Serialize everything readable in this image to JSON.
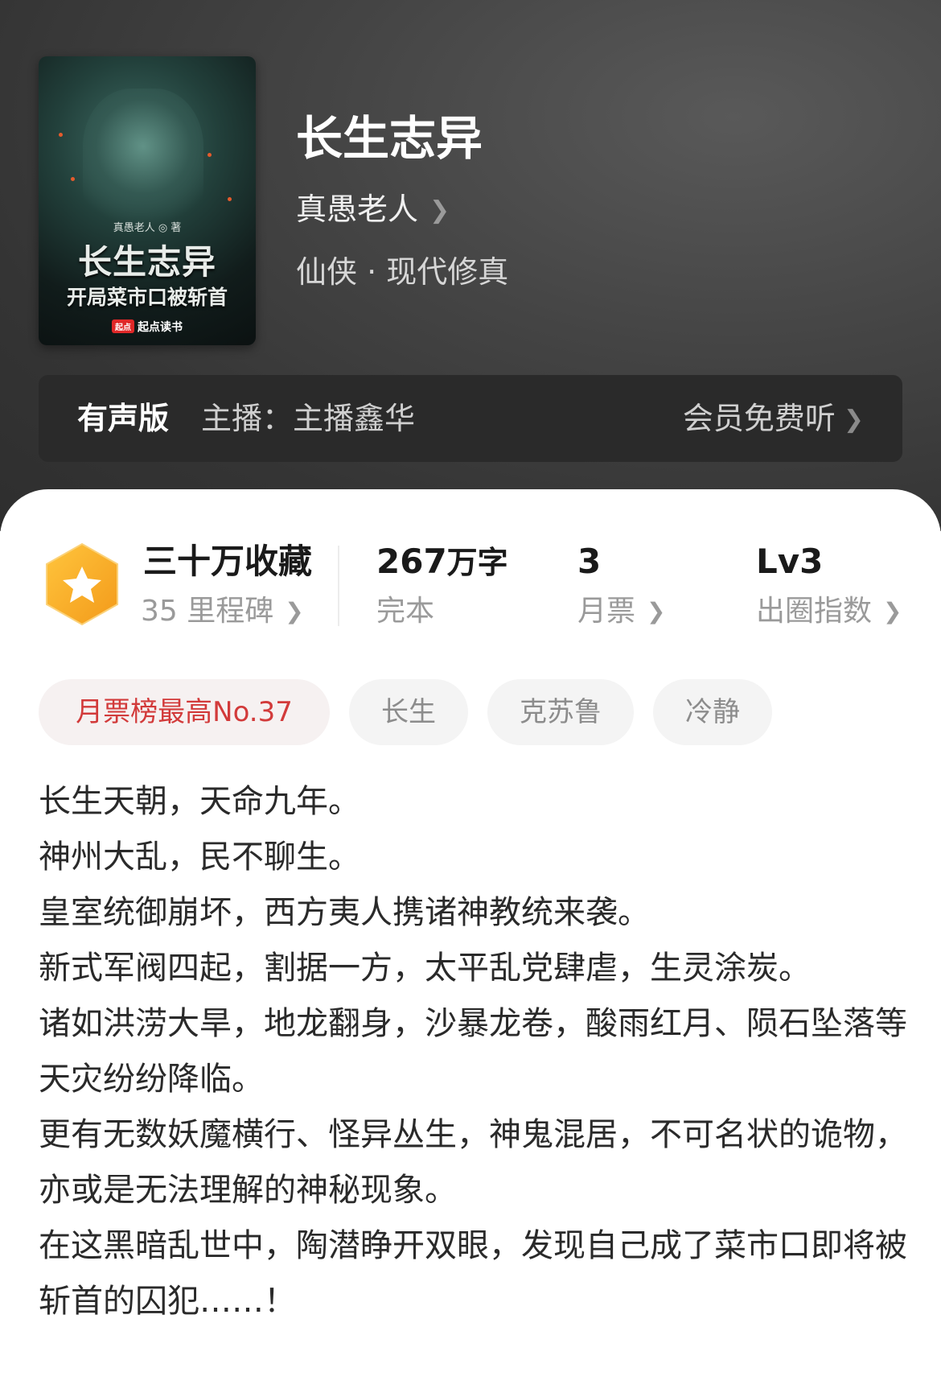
{
  "cover": {
    "author": "真愚老人 ◎ 著",
    "title": "长生志异",
    "subtitle": "开局菜市口被斩首",
    "publisher_badge": "起点",
    "publisher": "起点读书"
  },
  "book": {
    "title": "长生志异",
    "author": "真愚老人",
    "genre": "仙侠 · 现代修真"
  },
  "audio": {
    "label": "有声版",
    "host": "主播：主播鑫华",
    "cta": "会员免费听"
  },
  "stats": {
    "collection": {
      "main": "三十万收藏",
      "sub": "35 里程碑"
    },
    "words": {
      "number": "267",
      "unit": "万字",
      "sub": "完本"
    },
    "monthly_ticket": {
      "value": "3",
      "sub": "月票"
    },
    "influence": {
      "value": "Lv3",
      "sub": "出圈指数"
    }
  },
  "tags": [
    "月票榜最高No.37",
    "长生",
    "克苏鲁",
    "冷静"
  ],
  "colors": {
    "header_bg": "#3a3a3a",
    "accent_red": "#d23a3a",
    "badge_orange": "#f5a623"
  },
  "synopsis": [
    "长生天朝，天命九年。",
    "神州大乱，民不聊生。",
    "皇室统御崩坏，西方夷人携诸神教统来袭。",
    "新式军阀四起，割据一方，太平乱党肆虐，生灵涂炭。",
    "诸如洪涝大旱，地龙翻身，沙暴龙卷，酸雨红月、陨石坠落等天灾纷纷降临。",
    "更有无数妖魔横行、怪异丛生，神鬼混居，不可名状的诡物，亦或是无法理解的神秘现象。",
    "在这黑暗乱世中，陶潜睁开双眼，发现自己成了菜市口即将被斩首的囚犯……！"
  ]
}
